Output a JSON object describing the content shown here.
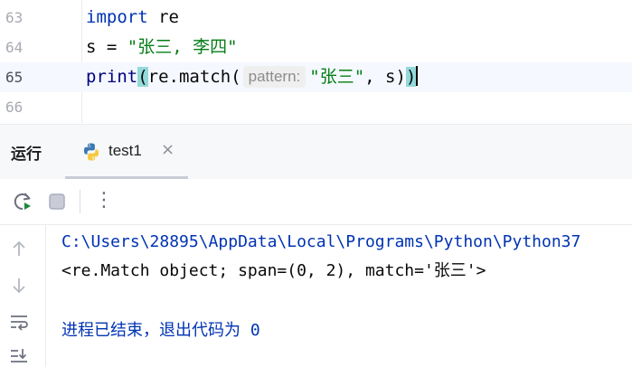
{
  "editor": {
    "lines": [
      {
        "number": "63"
      },
      {
        "number": "64"
      },
      {
        "number": "65"
      },
      {
        "number": "66"
      }
    ],
    "line63": {
      "kw": "import",
      "rest": " re"
    },
    "line64": {
      "var": "s = ",
      "str": "\"张三, 李四\""
    },
    "line65": {
      "print": "print",
      "open": "(",
      "call": "re.match(",
      "hint": "pattern:",
      "arg": "\"张三\"",
      "comma": ", s)",
      "close": ")"
    }
  },
  "tool_window": {
    "title": "运行",
    "tab_label": "test1",
    "close_glyph": "×"
  },
  "run_toolbar": {
    "buttons": [
      "rerun-icon",
      "stop-icon",
      "more-icon"
    ],
    "more_glyph": "⋮"
  },
  "console": {
    "lines": [
      "C:\\Users\\28895\\AppData\\Local\\Programs\\Python\\Python37",
      "<re.Match object; span=(0, 2), match='张三'>",
      "",
      "进程已结束，退出代码为 0"
    ],
    "side_buttons": [
      "arrow-up-icon",
      "arrow-down-icon",
      "soft-wrap-icon",
      "scroll-to-end-icon"
    ]
  },
  "colors": {
    "keyword": "#0033b3",
    "string": "#067d17",
    "brace_highlight": "#93d9d9",
    "current_line": "#f5f8fe"
  }
}
